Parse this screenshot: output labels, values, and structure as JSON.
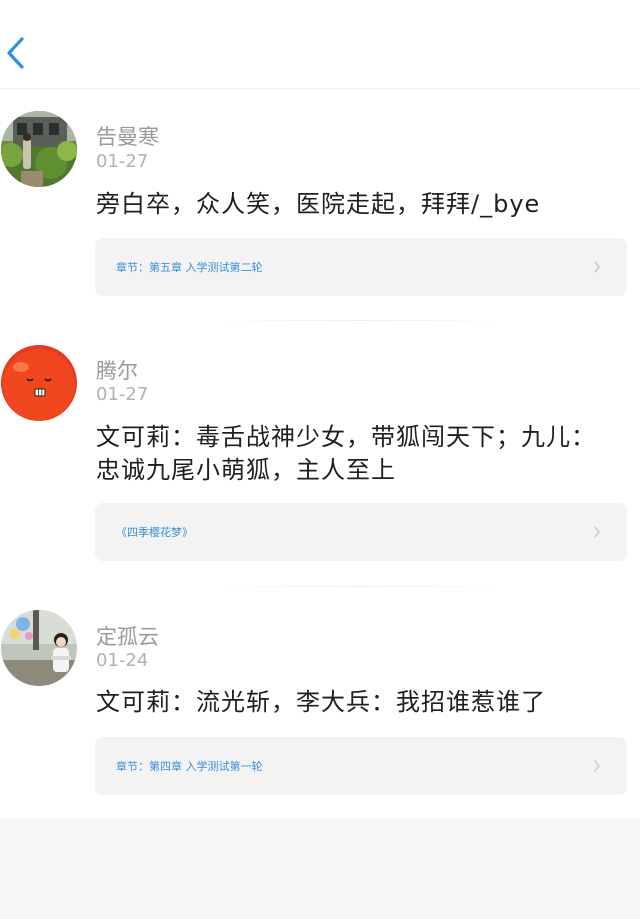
{
  "header": {
    "back_icon": "chevron-left-icon"
  },
  "comments": [
    {
      "user": "告曼寒",
      "date": "01-27",
      "text": "旁白卒，众人笑，医院走起，拜拜/_bye",
      "chapter": "章节：第五章 入学测试第二轮",
      "avatar": "garden-photo"
    },
    {
      "user": "腾尔",
      "date": "01-27",
      "text": "文可莉：毒舌战神少女，带狐闯天下；九儿：忠诚九尾小萌狐，主人至上",
      "chapter": "《四季樱花梦》",
      "avatar": "red-apple-cartoon"
    },
    {
      "user": "定孤云",
      "date": "01-24",
      "text": "文可莉：流光斩，李大兵：我招谁惹谁了",
      "chapter": "章节：第四章 入学测试第一轮",
      "avatar": "girl-park-photo"
    }
  ],
  "colors": {
    "accent": "#3a8fd8",
    "name": "#9a9a9a",
    "text": "#1f1f1f",
    "card": "#f3f3f3"
  }
}
